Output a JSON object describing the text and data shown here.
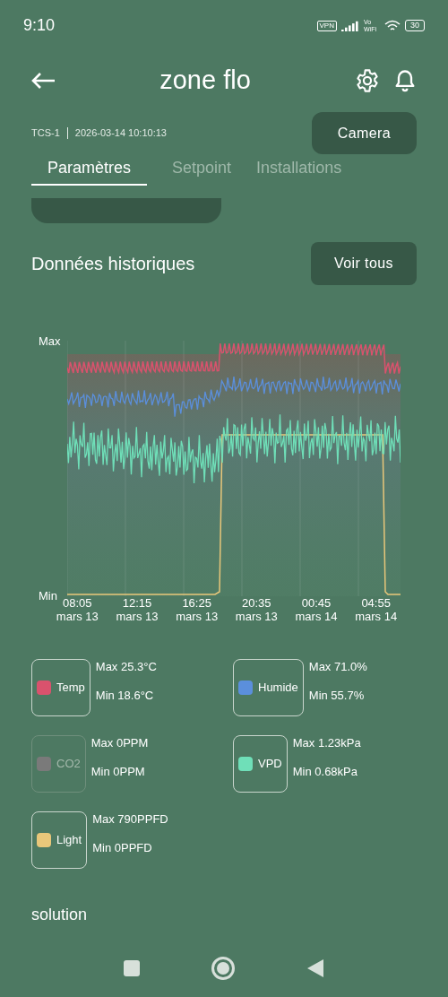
{
  "status_bar": {
    "time": "9:10",
    "vpn": "VPN",
    "volte": "Vo WiFi",
    "battery": "30"
  },
  "header": {
    "title": "zone flo"
  },
  "info": {
    "device": "TCS-1",
    "timestamp": "2026-03-14 10:10:13",
    "camera_button": "Camera"
  },
  "tabs": [
    {
      "label": "Paramètres",
      "selected": true
    },
    {
      "label": "Setpoint",
      "selected": false
    },
    {
      "label": "Installations",
      "selected": false
    }
  ],
  "history": {
    "title": "Données historiques",
    "button": "Voir tous",
    "chart": {
      "y_top": "Max",
      "y_bottom": "Min",
      "x_labels": [
        {
          "time": "08:05",
          "date": "mars 13"
        },
        {
          "time": "12:15",
          "date": "mars 13"
        },
        {
          "time": "16:25",
          "date": "mars 13"
        },
        {
          "time": "20:35",
          "date": "mars 13"
        },
        {
          "time": "00:45",
          "date": "mars 14"
        },
        {
          "time": "04:55",
          "date": "mars 14"
        }
      ]
    },
    "legend": [
      {
        "label": "Temp",
        "color": "#d9526d",
        "enabled": true,
        "max": "Max 25.3°C",
        "min": "Min 18.6°C"
      },
      {
        "label": "Humide",
        "color": "#5b8fdc",
        "enabled": true,
        "max": "Max 71.0%",
        "min": "Min 55.7%"
      },
      {
        "label": "CO2",
        "color": "#7a7a7a",
        "enabled": false,
        "max": "Max 0PPM",
        "min": "Min 0PPM"
      },
      {
        "label": "VPD",
        "color": "#6fdfb8",
        "enabled": true,
        "max": "Max 1.23kPa",
        "min": "Min 0.68kPa"
      },
      {
        "label": "Light",
        "color": "#e9c77a",
        "enabled": true,
        "max": "Max 790PPFD",
        "min": "Min 0PPFD"
      }
    ]
  },
  "next_section": {
    "title": "solution"
  }
}
